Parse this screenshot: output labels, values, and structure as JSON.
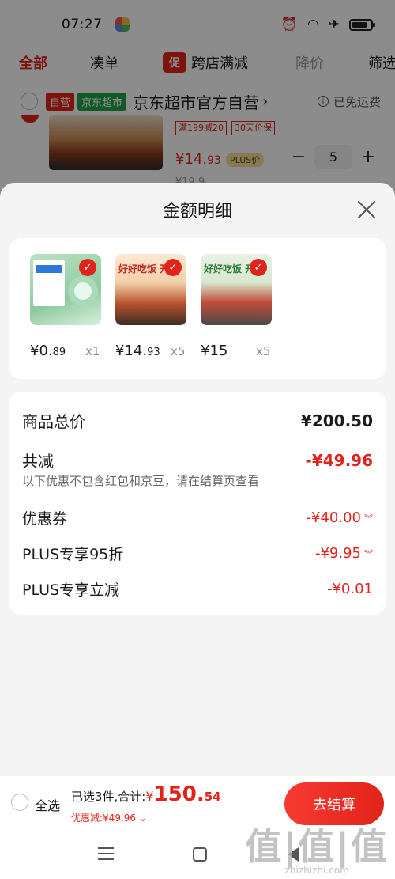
{
  "status_bar": {
    "time": "07:27"
  },
  "filter_tabs": {
    "all": "全部",
    "combo": "凑单",
    "promo_badge": "促",
    "promo": "跨店满减",
    "price_drop": "降价",
    "filter": "筛选"
  },
  "store": {
    "tag_self": "自营",
    "tag_market": "京东超市",
    "name": "京东超市官方自营",
    "free_shipping": "已免运费"
  },
  "bg_product": {
    "tags": [
      "满199减20",
      "30天价保"
    ],
    "price_yen": "¥",
    "price_main": "14.",
    "price_decimal": "93",
    "plus_tag": "PLUS价",
    "old_price": "¥19.9",
    "minus": "−",
    "qty": "5",
    "plus": "+"
  },
  "sheet": {
    "title": "金额明细",
    "goods": [
      {
        "headline": "",
        "price_main": "¥0.",
        "price_decimal": "89",
        "qty": "x1"
      },
      {
        "headline": "好好吃饭 开",
        "price_main": "¥14.",
        "price_decimal": "93",
        "qty": "x5"
      },
      {
        "headline": "好好吃饭 开",
        "price_main": "¥15",
        "price_decimal": "",
        "qty": "x5"
      }
    ],
    "detail": {
      "total_label": "商品总价",
      "total_value": "¥200.50",
      "discount_label": "共减",
      "discount_value": "-¥49.96",
      "note": "以下优惠不包含红包和京豆，请在结算页查看",
      "coupon_label": "优惠券",
      "coupon_value": "-¥40.00",
      "plus95_label": "PLUS专享95折",
      "plus95_value": "-¥9.95",
      "plusoff_label": "PLUS专享立减",
      "plusoff_value": "-¥0.01"
    }
  },
  "bottom_bar": {
    "select_all": "全选",
    "summary_prefix": "已选3件,合计:",
    "yen": "¥",
    "amount_main": "150.",
    "amount_decimal": "54",
    "saving": "优惠减:¥49.96",
    "checkout": "去结算"
  },
  "watermark": {
    "big": "值|值|值",
    "small": "zhizhizhi.com"
  },
  "colors": {
    "accent": "#e2231a",
    "green": "#21a24a",
    "background": "#f4f4f4"
  }
}
